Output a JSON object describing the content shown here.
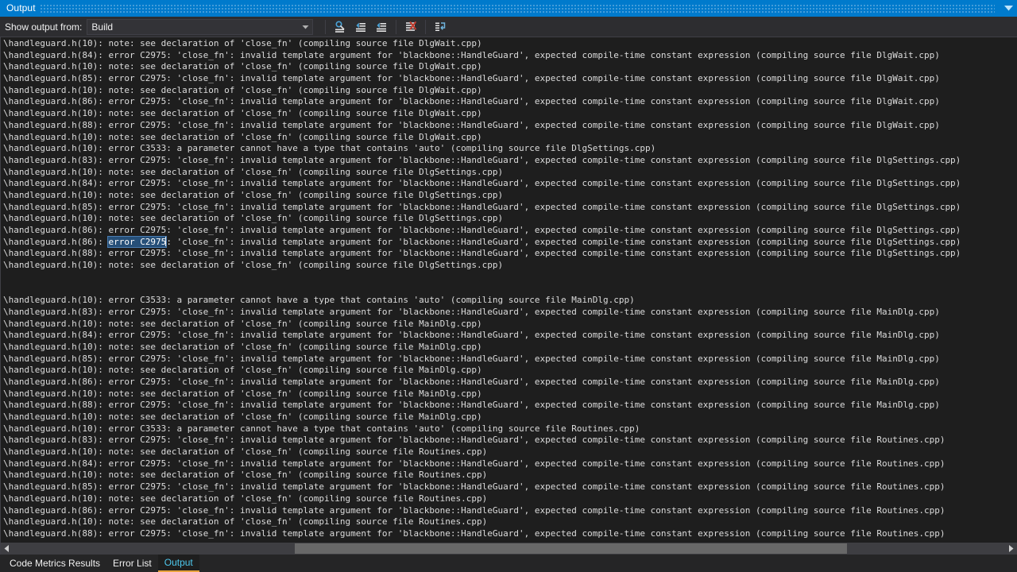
{
  "window": {
    "title": "Output",
    "chevron_icon": "chevron-down-icon"
  },
  "toolbar": {
    "show_output_from_label": "Show output from:",
    "source_selected": "Build",
    "source_options": [
      "Build"
    ],
    "dropdown_arrow_icon": "chevron-down-icon",
    "buttons": [
      {
        "name": "find-message-in-code-button",
        "icon": "goto-message-icon",
        "tooltip": "Go to Message"
      },
      {
        "name": "previous-message-button",
        "icon": "arrow-up-list-icon",
        "tooltip": "Go to Previous Message"
      },
      {
        "name": "next-message-button",
        "icon": "arrow-down-list-icon",
        "tooltip": "Go to Next Message"
      },
      {
        "name": "clear-all-button",
        "icon": "clear-all-icon",
        "tooltip": "Clear All"
      },
      {
        "name": "toggle-word-wrap-button",
        "icon": "word-wrap-icon",
        "tooltip": "Toggle Word Wrap"
      }
    ]
  },
  "selection": {
    "line_index": 17,
    "prefix": "\\handleguard.h(86): ",
    "selected_text": "error C2975",
    "suffix": ": 'close_fn': invalid template argument for 'blackbone::HandleGuard', expected compile-time constant expression (compiling source file DlgSettings.cpp)"
  },
  "output": {
    "lines": [
      "\\handleguard.h(10): note: see declaration of 'close_fn' (compiling source file DlgWait.cpp)",
      "\\handleguard.h(84): error C2975: 'close_fn': invalid template argument for 'blackbone::HandleGuard', expected compile-time constant expression (compiling source file DlgWait.cpp)",
      "\\handleguard.h(10): note: see declaration of 'close_fn' (compiling source file DlgWait.cpp)",
      "\\handleguard.h(85): error C2975: 'close_fn': invalid template argument for 'blackbone::HandleGuard', expected compile-time constant expression (compiling source file DlgWait.cpp)",
      "\\handleguard.h(10): note: see declaration of 'close_fn' (compiling source file DlgWait.cpp)",
      "\\handleguard.h(86): error C2975: 'close_fn': invalid template argument for 'blackbone::HandleGuard', expected compile-time constant expression (compiling source file DlgWait.cpp)",
      "\\handleguard.h(10): note: see declaration of 'close_fn' (compiling source file DlgWait.cpp)",
      "\\handleguard.h(88): error C2975: 'close_fn': invalid template argument for 'blackbone::HandleGuard', expected compile-time constant expression (compiling source file DlgWait.cpp)",
      "\\handleguard.h(10): note: see declaration of 'close_fn' (compiling source file DlgWait.cpp)",
      "\\handleguard.h(10): error C3533: a parameter cannot have a type that contains 'auto' (compiling source file DlgSettings.cpp)",
      "\\handleguard.h(83): error C2975: 'close_fn': invalid template argument for 'blackbone::HandleGuard', expected compile-time constant expression (compiling source file DlgSettings.cpp)",
      "\\handleguard.h(10): note: see declaration of 'close_fn' (compiling source file DlgSettings.cpp)",
      "\\handleguard.h(84): error C2975: 'close_fn': invalid template argument for 'blackbone::HandleGuard', expected compile-time constant expression (compiling source file DlgSettings.cpp)",
      "\\handleguard.h(10): note: see declaration of 'close_fn' (compiling source file DlgSettings.cpp)",
      "\\handleguard.h(85): error C2975: 'close_fn': invalid template argument for 'blackbone::HandleGuard', expected compile-time constant expression (compiling source file DlgSettings.cpp)",
      "\\handleguard.h(10): note: see declaration of 'close_fn' (compiling source file DlgSettings.cpp)",
      "\\handleguard.h(86): error C2975: 'close_fn': invalid template argument for 'blackbone::HandleGuard', expected compile-time constant expression (compiling source file DlgSettings.cpp)",
      "\\handleguard.h(10): note: see declaration of 'close_fn' (compiling source file DlgSettings.cpp)",
      "\\handleguard.h(88): error C2975: 'close_fn': invalid template argument for 'blackbone::HandleGuard', expected compile-time constant expression (compiling source file DlgSettings.cpp)",
      "\\handleguard.h(10): note: see declaration of 'close_fn' (compiling source file DlgSettings.cpp)",
      "",
      "",
      "\\handleguard.h(10): error C3533: a parameter cannot have a type that contains 'auto' (compiling source file MainDlg.cpp)",
      "\\handleguard.h(83): error C2975: 'close_fn': invalid template argument for 'blackbone::HandleGuard', expected compile-time constant expression (compiling source file MainDlg.cpp)",
      "\\handleguard.h(10): note: see declaration of 'close_fn' (compiling source file MainDlg.cpp)",
      "\\handleguard.h(84): error C2975: 'close_fn': invalid template argument for 'blackbone::HandleGuard', expected compile-time constant expression (compiling source file MainDlg.cpp)",
      "\\handleguard.h(10): note: see declaration of 'close_fn' (compiling source file MainDlg.cpp)",
      "\\handleguard.h(85): error C2975: 'close_fn': invalid template argument for 'blackbone::HandleGuard', expected compile-time constant expression (compiling source file MainDlg.cpp)",
      "\\handleguard.h(10): note: see declaration of 'close_fn' (compiling source file MainDlg.cpp)",
      "\\handleguard.h(86): error C2975: 'close_fn': invalid template argument for 'blackbone::HandleGuard', expected compile-time constant expression (compiling source file MainDlg.cpp)",
      "\\handleguard.h(10): note: see declaration of 'close_fn' (compiling source file MainDlg.cpp)",
      "\\handleguard.h(88): error C2975: 'close_fn': invalid template argument for 'blackbone::HandleGuard', expected compile-time constant expression (compiling source file MainDlg.cpp)",
      "\\handleguard.h(10): note: see declaration of 'close_fn' (compiling source file MainDlg.cpp)",
      "\\handleguard.h(10): error C3533: a parameter cannot have a type that contains 'auto' (compiling source file Routines.cpp)",
      "\\handleguard.h(83): error C2975: 'close_fn': invalid template argument for 'blackbone::HandleGuard', expected compile-time constant expression (compiling source file Routines.cpp)",
      "\\handleguard.h(10): note: see declaration of 'close_fn' (compiling source file Routines.cpp)",
      "\\handleguard.h(84): error C2975: 'close_fn': invalid template argument for 'blackbone::HandleGuard', expected compile-time constant expression (compiling source file Routines.cpp)",
      "\\handleguard.h(10): note: see declaration of 'close_fn' (compiling source file Routines.cpp)",
      "\\handleguard.h(85): error C2975: 'close_fn': invalid template argument for 'blackbone::HandleGuard', expected compile-time constant expression (compiling source file Routines.cpp)",
      "\\handleguard.h(10): note: see declaration of 'close_fn' (compiling source file Routines.cpp)",
      "\\handleguard.h(86): error C2975: 'close_fn': invalid template argument for 'blackbone::HandleGuard', expected compile-time constant expression (compiling source file Routines.cpp)",
      "\\handleguard.h(10): note: see declaration of 'close_fn' (compiling source file Routines.cpp)",
      "\\handleguard.h(88): error C2975: 'close_fn': invalid template argument for 'blackbone::HandleGuard', expected compile-time constant expression (compiling source file Routines.cpp)"
    ]
  },
  "scrollbar": {
    "left_arrow_icon": "arrow-left-icon",
    "right_arrow_icon": "arrow-right-icon"
  },
  "tabs": [
    {
      "label": "Code Metrics Results",
      "name": "tab-code-metrics-results",
      "active": false
    },
    {
      "label": "Error List",
      "name": "tab-error-list",
      "active": false
    },
    {
      "label": "Output",
      "name": "tab-output",
      "active": true
    }
  ],
  "colors": {
    "titlebar": "#007acc",
    "toolbar": "#2d2d30",
    "output_bg": "#1e1e1e",
    "output_text": "#dcdcdc",
    "selection_bg": "#264f78",
    "active_tab_text": "#4ec9ef",
    "active_tab_underline": "#e8a33d",
    "scrollbar_thumb": "#686868"
  }
}
